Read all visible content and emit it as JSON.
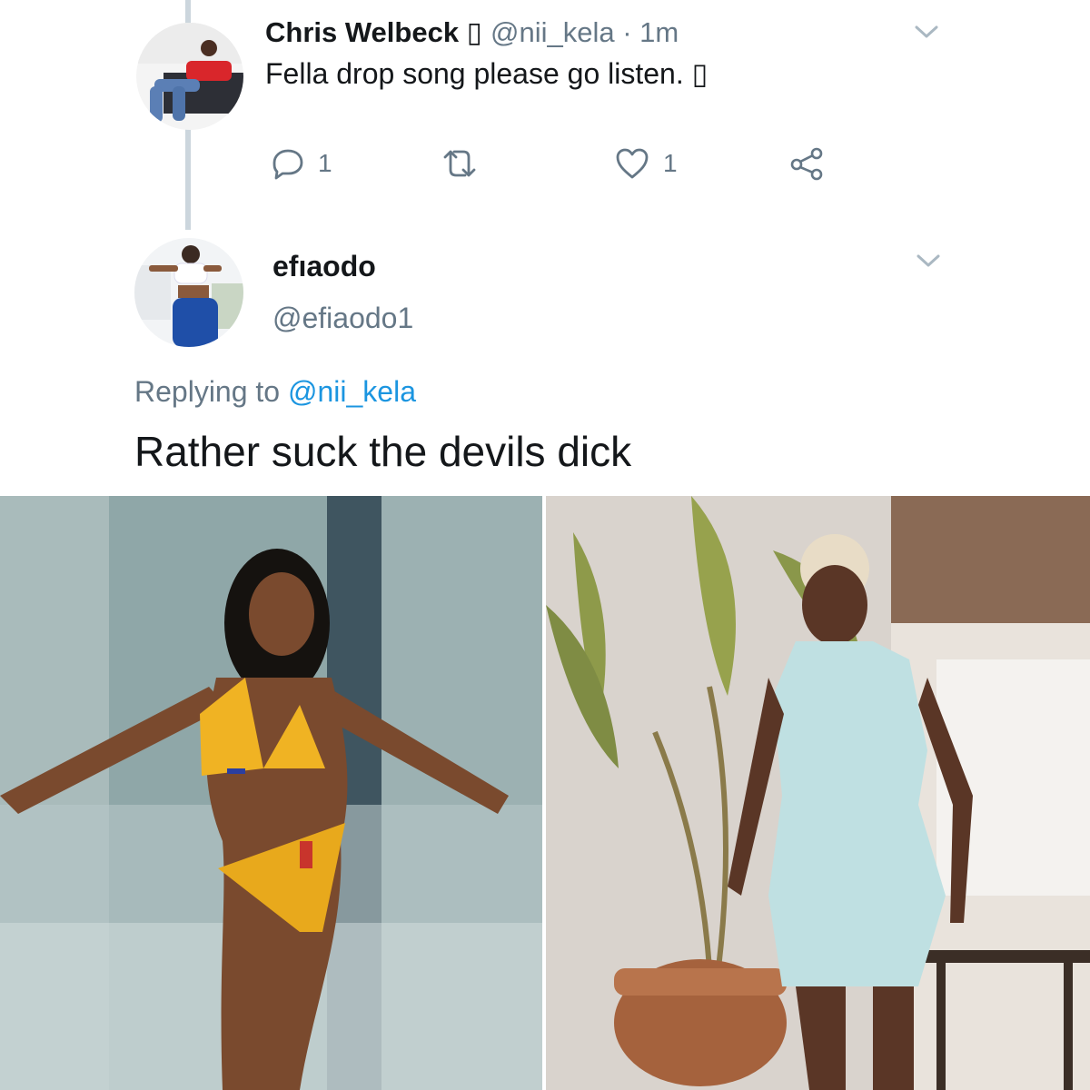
{
  "parent_tweet": {
    "author_name": "Chris Welbeck",
    "author_badge_glyph": "▯",
    "handle": "@nii_kela",
    "separator": "·",
    "time": "1m",
    "text": "Fella drop song please go listen. ▯",
    "reply_count": "1",
    "like_count": "1",
    "avatar_icon": "avatar-photo-man-on-couch"
  },
  "reply_tweet": {
    "author_name": "efıaodo",
    "handle": "@efiaodo1",
    "replying_prefix": "Replying to",
    "replying_to": "@nii_kela",
    "text": "Rather suck the devils dick",
    "avatar_icon": "avatar-photo-woman"
  },
  "media": [
    {
      "name": "photo-left",
      "icon": "photo-woman-in-bikini"
    },
    {
      "name": "photo-right",
      "icon": "photo-woman-in-light-blue-dress"
    }
  ],
  "colors": {
    "text_primary": "#14171a",
    "text_secondary": "#657786",
    "link": "#1b95e0",
    "thread_line": "#ccd6dd"
  }
}
